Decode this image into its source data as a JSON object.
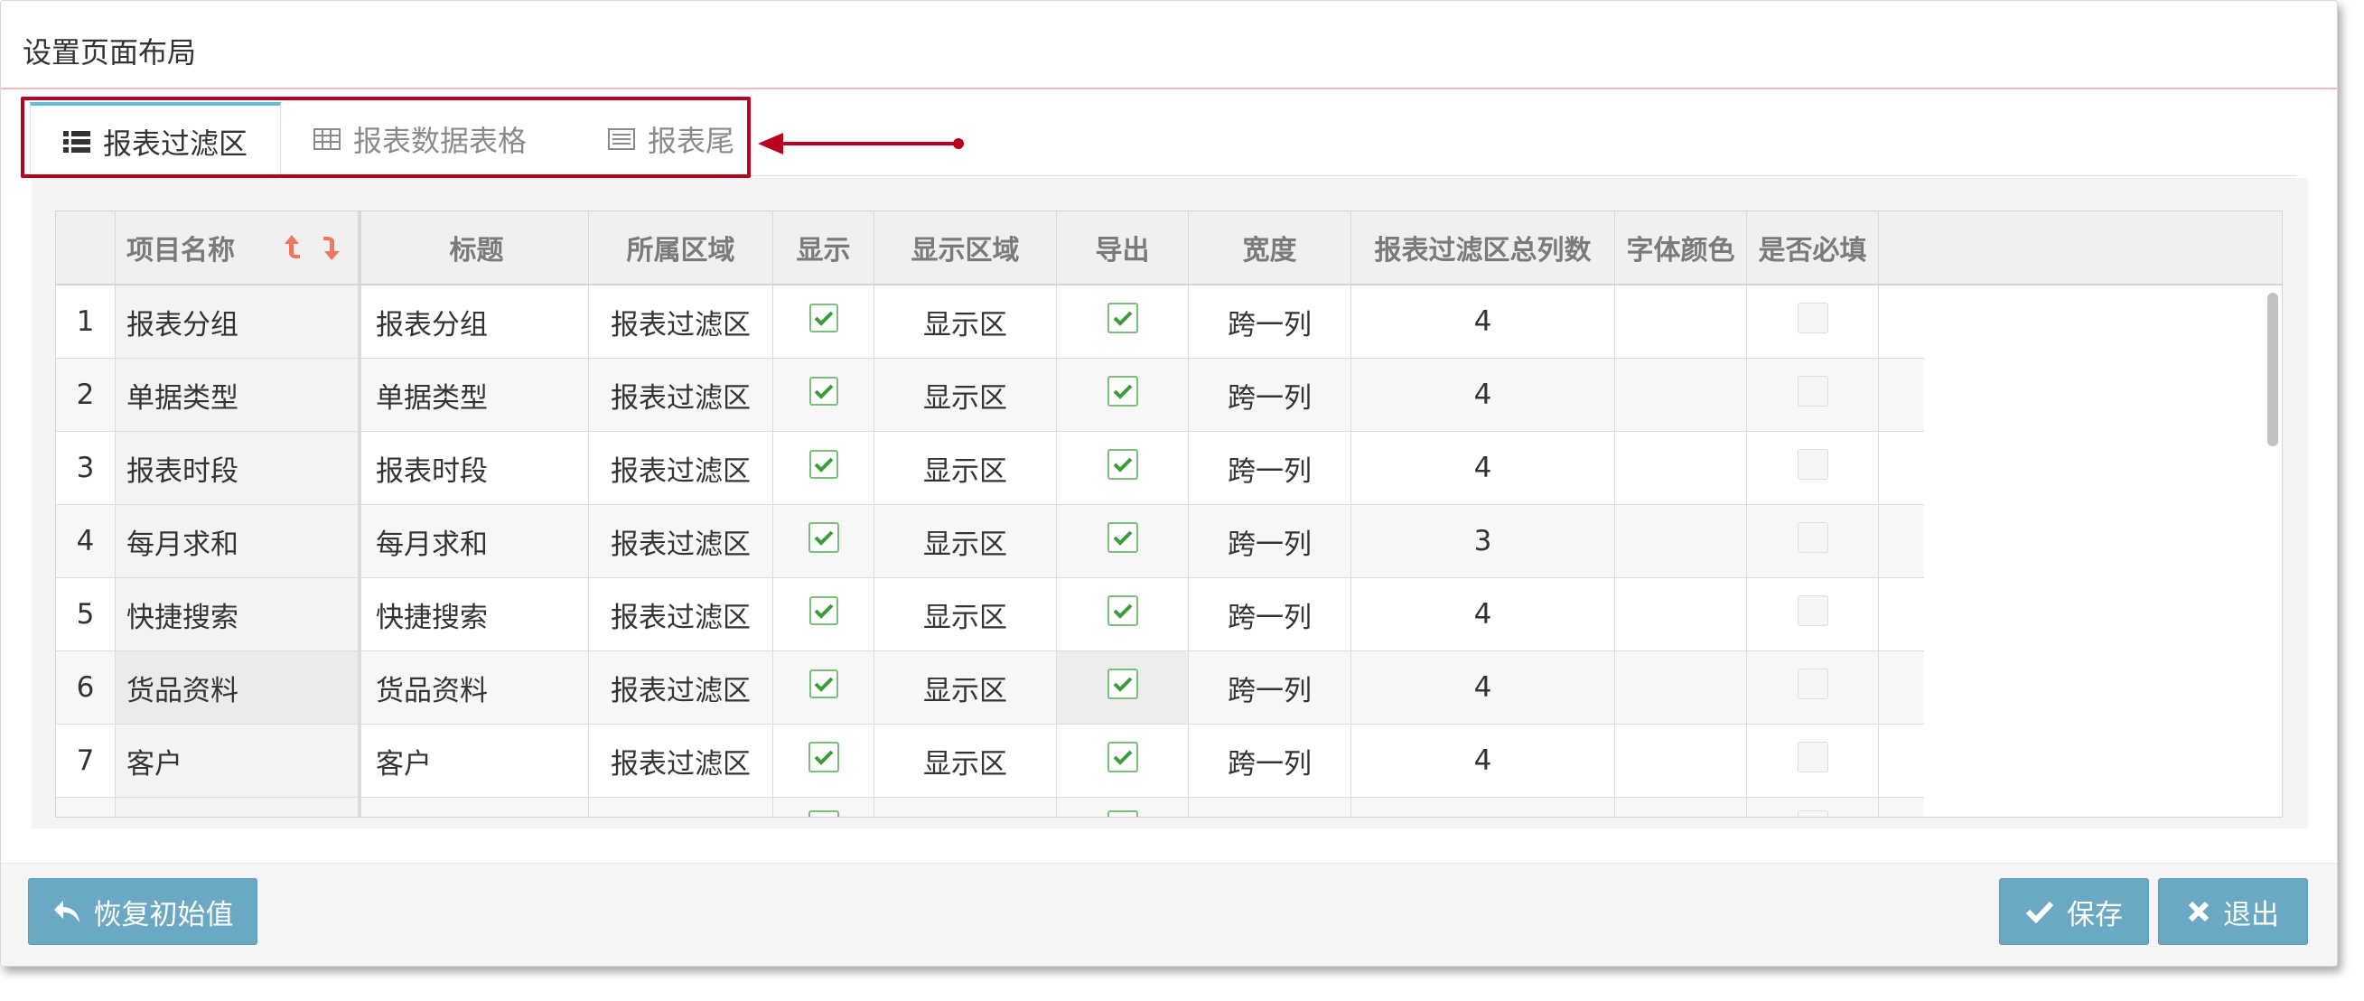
{
  "dialog": {
    "title": "设置页面布局"
  },
  "tabs": [
    {
      "label": "报表过滤区",
      "icon": "list-icon",
      "active": true
    },
    {
      "label": "报表数据表格",
      "icon": "table-icon",
      "active": false
    },
    {
      "label": "报表尾",
      "icon": "footer-list-icon",
      "active": false
    }
  ],
  "grid": {
    "columns": [
      "项目名称",
      "标题",
      "所属区域",
      "显示",
      "显示区域",
      "导出",
      "宽度",
      "报表过滤区总列数",
      "字体颜色",
      "是否必填"
    ],
    "rows": [
      {
        "num": "1",
        "name": "报表分组",
        "title": "报表分组",
        "area": "报表过滤区",
        "show": true,
        "show_area": "显示区",
        "export": true,
        "width": "跨一列",
        "total_cols": "4",
        "font_color": "",
        "required": false
      },
      {
        "num": "2",
        "name": "单据类型",
        "title": "单据类型",
        "area": "报表过滤区",
        "show": true,
        "show_area": "显示区",
        "export": true,
        "width": "跨一列",
        "total_cols": "4",
        "font_color": "",
        "required": false
      },
      {
        "num": "3",
        "name": "报表时段",
        "title": "报表时段",
        "area": "报表过滤区",
        "show": true,
        "show_area": "显示区",
        "export": true,
        "width": "跨一列",
        "total_cols": "4",
        "font_color": "",
        "required": false
      },
      {
        "num": "4",
        "name": "每月求和",
        "title": "每月求和",
        "area": "报表过滤区",
        "show": true,
        "show_area": "显示区",
        "export": true,
        "width": "跨一列",
        "total_cols": "3",
        "font_color": "",
        "required": false
      },
      {
        "num": "5",
        "name": "快捷搜索",
        "title": "快捷搜索",
        "area": "报表过滤区",
        "show": true,
        "show_area": "显示区",
        "export": true,
        "width": "跨一列",
        "total_cols": "4",
        "font_color": "",
        "required": false
      },
      {
        "num": "6",
        "name": "货品资料",
        "title": "货品资料",
        "area": "报表过滤区",
        "show": true,
        "show_area": "显示区",
        "export": true,
        "width": "跨一列",
        "total_cols": "4",
        "font_color": "",
        "required": false
      },
      {
        "num": "7",
        "name": "客户",
        "title": "客户",
        "area": "报表过滤区",
        "show": true,
        "show_area": "显示区",
        "export": true,
        "width": "跨一列",
        "total_cols": "4",
        "font_color": "",
        "required": false
      }
    ]
  },
  "footer": {
    "restore_label": "恢复初始值",
    "save_label": "保存",
    "exit_label": "退出"
  },
  "colors": {
    "accent": "#5bc0de",
    "button": "#6aa8c4",
    "highlight": "#b8001f",
    "check": "#3c9c3c",
    "sort": "#ee7762"
  }
}
